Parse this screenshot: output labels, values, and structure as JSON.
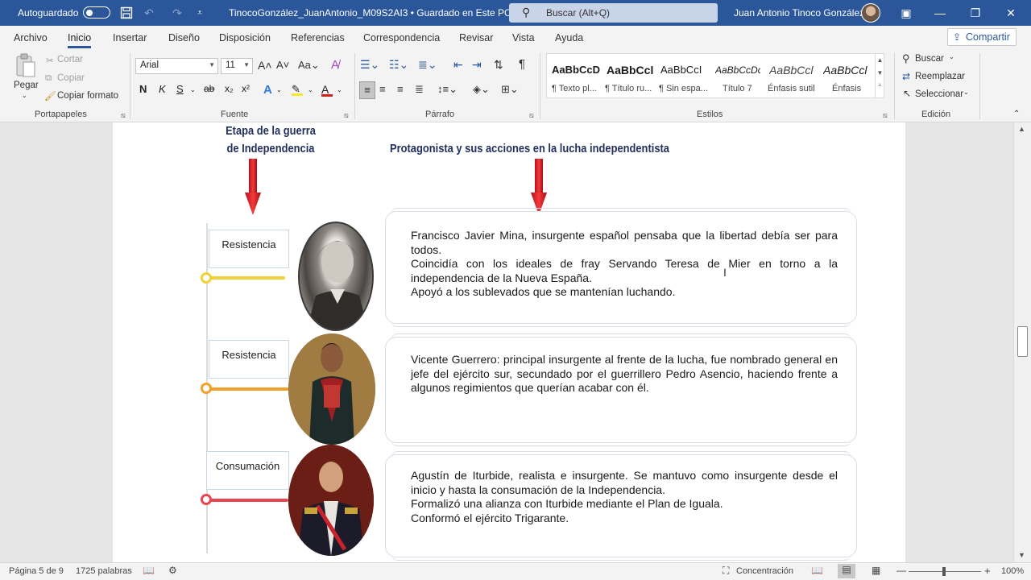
{
  "titlebar": {
    "autosave_label": "Autoguardado",
    "doc_title": "TinocoGonzález_JuanAntonio_M09S2AI3 • Guardado en Este PC ⌄",
    "search_placeholder": "Buscar (Alt+Q)",
    "user_name": "Juan Antonio Tinoco González"
  },
  "tabs": [
    "Archivo",
    "Inicio",
    "Insertar",
    "Diseño",
    "Disposición",
    "Referencias",
    "Correspondencia",
    "Revisar",
    "Vista",
    "Ayuda"
  ],
  "share_label": "Compartir",
  "clipboard": {
    "paste": "Pegar",
    "cut": "Cortar",
    "copy": "Copiar",
    "format_painter": "Copiar formato",
    "group": "Portapapeles"
  },
  "font": {
    "name": "Arial",
    "size": "11",
    "group": "Fuente"
  },
  "paragraph": {
    "group": "Párrafo"
  },
  "styles": {
    "group": "Estilos",
    "items": [
      {
        "sample": "AaBbCcD",
        "name": "¶ Texto pl..."
      },
      {
        "sample": "AaBbCcl",
        "name": "¶ Título ru..."
      },
      {
        "sample": "AaBbCcI",
        "name": "¶ Sin espa..."
      },
      {
        "sample": "AaBbCcDc",
        "name": "Título 7"
      },
      {
        "sample": "AaBbCcl",
        "name": "Énfasis sutil"
      },
      {
        "sample": "AaBbCcl",
        "name": "Énfasis"
      }
    ]
  },
  "editing": {
    "find": "Buscar",
    "replace": "Reemplazar",
    "select": "Seleccionar",
    "group": "Edición"
  },
  "document": {
    "heading_stage": "Etapa de la guerra\nde Independencia",
    "heading_protagonist": "Protagonista y sus acciones en la lucha independentista",
    "rows": [
      {
        "stage": "Resistencia",
        "color": "#f0d13a",
        "text": [
          "Francisco Javier Mina, insurgente español pensaba que la libertad debía ser para todos.",
          "Coincidía con los ideales de fray Servando Teresa de Mier en torno a la independencia de la Nueva España.",
          "Apoyó a los sublevados que se mantenían luchando."
        ]
      },
      {
        "stage": "Resistencia",
        "color": "#f0a12a",
        "text": [
          "Vicente Guerrero: principal insurgente al frente de la lucha, fue nombrado general en jefe del ejército sur, secundado por el guerrillero Pedro Asencio, haciendo frente a algunos regimientos que querían acabar con él."
        ]
      },
      {
        "stage": "Consumación",
        "color": "#e8454e",
        "text": [
          "Agustín de Iturbide, realista e insurgente. Se mantuvo como insurgente desde el inicio y hasta la consumación de la Independencia.",
          "Formalizó una alianza con Iturbide mediante el Plan de Iguala.",
          "Conformó el ejército Trigarante."
        ]
      }
    ]
  },
  "statusbar": {
    "page": "Página 5 de 9",
    "words": "1725 palabras",
    "focus": "Concentración",
    "zoom": "100%"
  }
}
